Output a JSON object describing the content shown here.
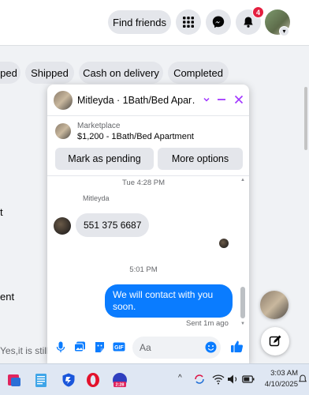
{
  "header": {
    "find_friends_label": "Find friends",
    "notification_count": "4"
  },
  "filters": {
    "chips": [
      "ped",
      "Shipped",
      "Cash on delivery",
      "Completed"
    ]
  },
  "background": {
    "line_t": "t",
    "line_ent": "ent",
    "preview_text": "Yes,it is still"
  },
  "chat": {
    "title": "Mitleyda · 1Bath/Bed Apar…",
    "listing": {
      "label": "Marketplace",
      "title": "$1,200 - 1Bath/Bed Apartment",
      "mark_pending_label": "Mark as pending",
      "more_options_label": "More options"
    },
    "messages": {
      "timestamp_1": "Tue 4:28 PM",
      "sender_name": "Mitleyda",
      "incoming_text": "551 375 6687",
      "timestamp_2": "5:01 PM",
      "outgoing_text": "We will contact with you soon.",
      "sent_status": "Sent 1m ago"
    },
    "composer": {
      "placeholder": "Aa"
    }
  },
  "taskbar": {
    "time": "3:03 AM",
    "date": "4/10/2025",
    "badge_text": "2:28"
  },
  "colors": {
    "accent": "#0a7cff",
    "chat_header_icons": "#a033ff",
    "badge": "#e41e3f"
  }
}
